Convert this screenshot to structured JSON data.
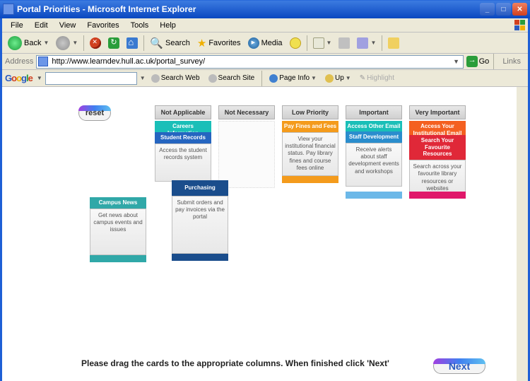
{
  "window": {
    "title": "Portal Priorities - Microsoft Internet Explorer"
  },
  "menu": {
    "file": "File",
    "edit": "Edit",
    "view": "View",
    "favorites": "Favorites",
    "tools": "Tools",
    "help": "Help"
  },
  "toolbar": {
    "back": "Back",
    "search": "Search",
    "favorites": "Favorites",
    "media": "Media"
  },
  "address": {
    "label": "Address",
    "url": "http://www.learndev.hull.ac.uk/portal_survey/",
    "go": "Go",
    "links": "Links"
  },
  "google": {
    "searchweb": "Search Web",
    "searchsite": "Search Site",
    "pageinfo": "Page Info",
    "up": "Up",
    "highlight": "Highlight"
  },
  "reset": "reset",
  "next": "Next",
  "cols": {
    "na": "Not Applicable",
    "nn": "Not Necessary",
    "lp": "Low Priority",
    "im": "Important",
    "vi": "Very Important"
  },
  "cards": {
    "campus_news": {
      "title": "Campus News",
      "body": "Get news about campus events and issues"
    },
    "careers": {
      "title": "Careers Information"
    },
    "student_records": {
      "title": "Student Records",
      "body": "Access the student records system"
    },
    "purchasing": {
      "title": "Purchasing",
      "body": "Submit orders and pay invoices via the portal"
    },
    "pay_fines": {
      "title": "Pay Fines and Fees",
      "body": "View your institutional financial status. Pay library fines and course fees online"
    },
    "other_email": {
      "title": "Access Other Email"
    },
    "staff_dev": {
      "title": "Staff Development",
      "body": "Receive alerts about staff development events and workshops"
    },
    "inst_email": {
      "title": "Access Your Institutional Email"
    },
    "fav_res": {
      "title": "Search Your Favourite Resources",
      "body": "Search across your favourite library resources or websites"
    }
  },
  "instruction": "Please drag the cards to the appropriate columns.  When finished click 'Next'"
}
